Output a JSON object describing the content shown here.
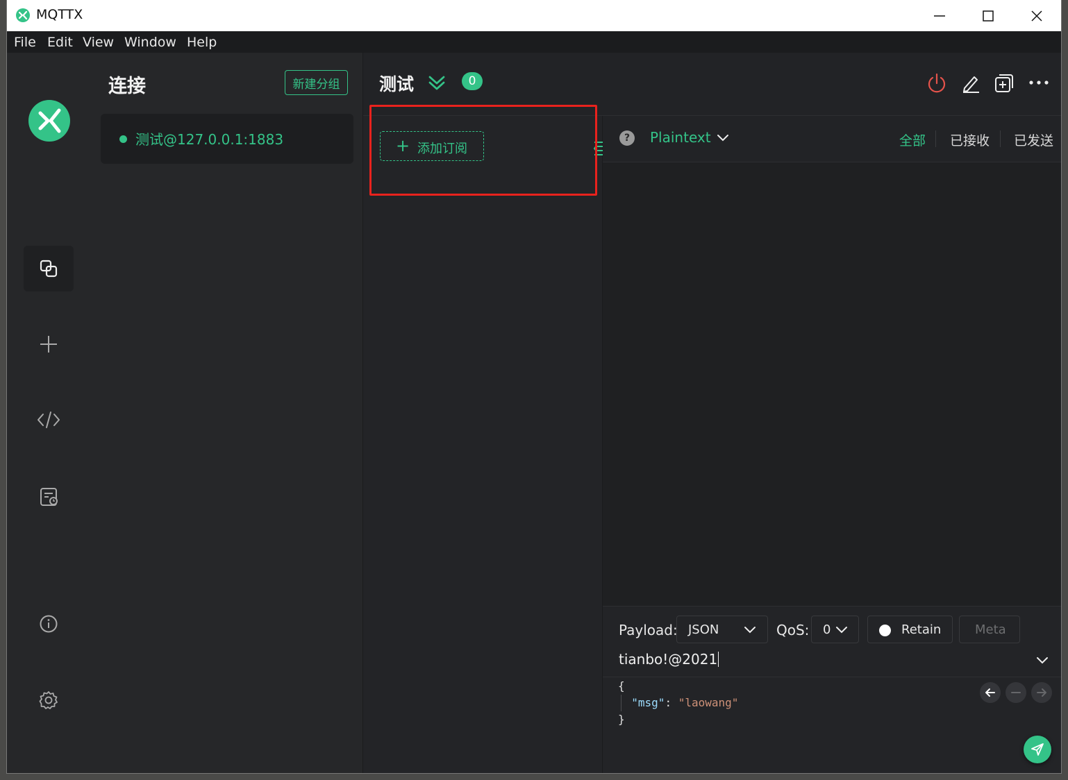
{
  "window": {
    "title": "MQTTX",
    "controls": [
      "minimize-icon",
      "maximize-icon",
      "close-icon"
    ]
  },
  "menu": [
    "File",
    "Edit",
    "View",
    "Window",
    "Help"
  ],
  "nav": {
    "items": [
      "connections-icon",
      "plus-icon",
      "code-icon",
      "log-icon",
      "info-icon",
      "gear-icon"
    ],
    "active": "connections-icon"
  },
  "connections": {
    "title": "连接",
    "new_group_label": "新建分组",
    "items": [
      {
        "label": "测试@127.0.0.1:1883",
        "status": "connected"
      }
    ]
  },
  "connection_header": {
    "name": "测试",
    "unread_count": "0",
    "actions": [
      "power-icon",
      "edit-icon",
      "new-window-icon",
      "more-icon"
    ]
  },
  "subscriptions": {
    "add_label": "添加订阅"
  },
  "messages": {
    "payload_view": "Plaintext",
    "filters": [
      "全部",
      "已接收",
      "已发送"
    ],
    "active_filter": "全部"
  },
  "composer": {
    "payload_label": "Payload:",
    "payload_format": "JSON",
    "qos_label": "QoS:",
    "qos_value": "0",
    "retain_label": "Retain",
    "meta_label": "Meta",
    "topic": "tianbo!@2021",
    "payload_lines": [
      "{",
      "  \"msg\": \"laowang\"",
      "}"
    ],
    "payload_key": "\"msg\"",
    "payload_value": "\"laowang\""
  },
  "colors": {
    "accent": "#34c388",
    "highlight_box": "#e8221d",
    "power": "#e5534b"
  }
}
